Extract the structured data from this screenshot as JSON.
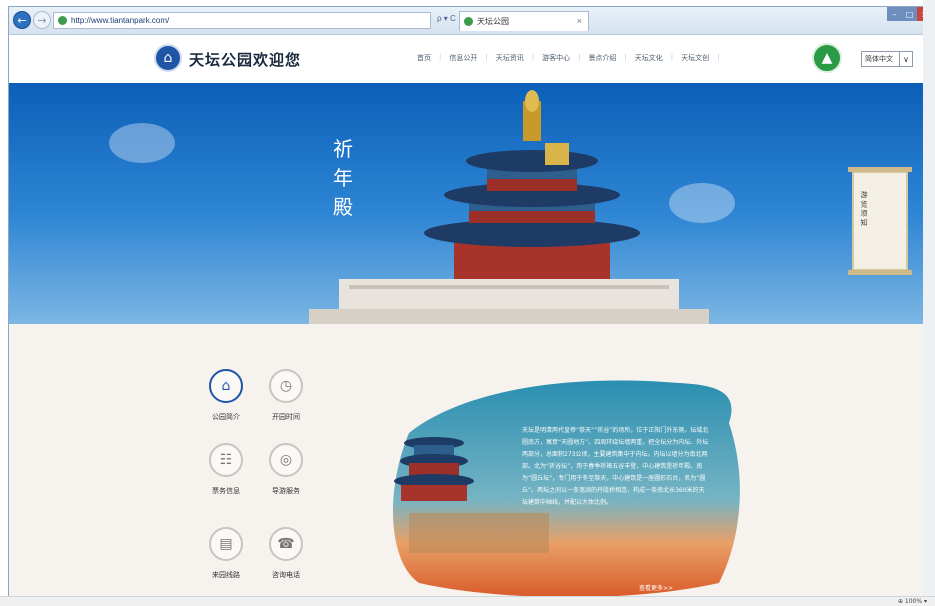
{
  "browser": {
    "address": "http://www.tiantanpark.com/",
    "address_tools": "ρ ▾ C",
    "tab_title": "天坛公园",
    "tab_close": "×",
    "back_glyph": "←",
    "forward_glyph": "→",
    "window_controls": [
      "–",
      "□",
      "×"
    ],
    "zoom": "⊕ 100% ▾"
  },
  "header": {
    "site_name": "天坛公园欢迎您",
    "nav": [
      "首页",
      "信息公开",
      "天坛资讯",
      "游客中心",
      "景点介绍",
      "天坛文化",
      "天坛文创"
    ],
    "language": "简体中文",
    "language_arrow": "∨"
  },
  "hero": {
    "title_chars": [
      "祈",
      "年",
      "殿"
    ],
    "scroll_text": "游 览 须 知"
  },
  "tiles": [
    {
      "label": "公园简介",
      "icon": "temple-icon",
      "glyph": "⌂"
    },
    {
      "label": "开园时间",
      "icon": "calendar-clock-icon",
      "glyph": "◷"
    },
    {
      "label": "票务信息",
      "icon": "ticket-icon",
      "glyph": "☷"
    },
    {
      "label": "导游服务",
      "icon": "guide-icon",
      "glyph": "◎"
    },
    {
      "label": "来园线路",
      "icon": "map-icon",
      "glyph": "▤"
    },
    {
      "label": "咨询电话",
      "icon": "telephone-icon",
      "glyph": "☎"
    }
  ],
  "intro": {
    "text": "天坛是明清两代皇帝“祭天”“祈谷”的场所，位于正阳门外东侧。坛域北圆南方，寓意“天圆地方”。四周环绕坛墙两重，把全坛分为内坛、外坛两部分，总面积273公顷，主要建筑集中于内坛。内坛以墙分为南北两部。北为“祈谷坛”，用于春季祈祷五谷丰登，中心建筑是祈年殿。南为“圆丘坛”，专门用于冬至祭天，中心建筑是一座圆形石台，名为“圆丘”。两坛之间以一条宽阔的丹陡桥相连，构成一条南北长360米的天坛建筑中轴线，并配以大体比例。",
    "read_more": "查看更多>>"
  }
}
